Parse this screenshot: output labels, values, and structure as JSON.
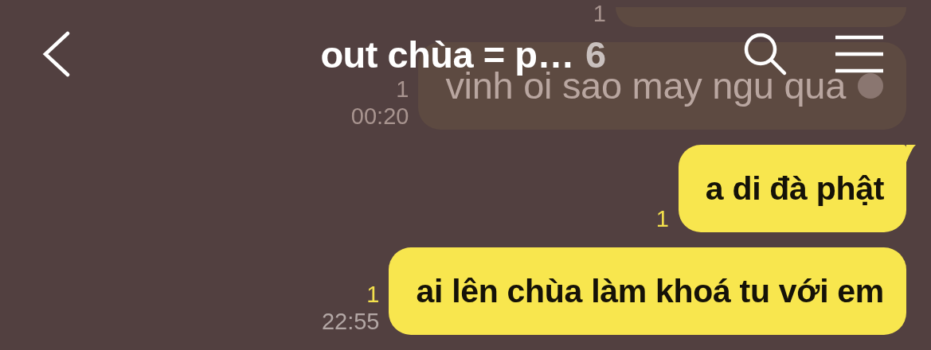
{
  "header": {
    "title": "out chùa = p…",
    "member_count": "6"
  },
  "messages": [
    {
      "kind": "faded",
      "read_count": "1"
    },
    {
      "kind": "faded",
      "text": "vinh oi sao may ngu qua",
      "emoji": true,
      "read_count": "1",
      "time": "00:20"
    },
    {
      "kind": "mine",
      "text": "a di đà phật",
      "tail": true,
      "read_count": "1"
    },
    {
      "kind": "mine",
      "text": "ai lên chùa làm khoá tu với em",
      "tail": false,
      "read_count": "1",
      "time": "22:55"
    }
  ]
}
